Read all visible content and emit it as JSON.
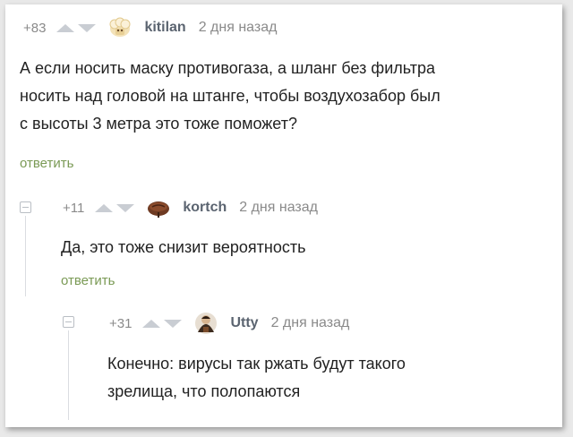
{
  "comments": [
    {
      "rating": "+83",
      "author": "kitilan",
      "time": "2 дня назад",
      "text_lines": [
        "А если носить маску противогаза, а шланг без фильтра",
        "носить над головой на штанге, чтобы воздухозабор был",
        "с высоты 3 метра это тоже поможет?"
      ],
      "reply": "ответить",
      "avatar_icon": "sheep-avatar-icon"
    },
    {
      "rating": "+11",
      "author": "kortch",
      "time": "2 дня назад",
      "text_lines": [
        "Да, это тоже снизит вероятность"
      ],
      "reply": "ответить",
      "avatar_icon": "bread-avatar-icon"
    },
    {
      "rating": "+31",
      "author": "Utty",
      "time": "2 дня назад",
      "text_lines": [
        "Конечно: вирусы так ржать будут такого",
        "зрелища, что полопаются"
      ],
      "avatar_icon": "cartoon-avatar-icon"
    }
  ],
  "colors": {
    "reply_link": "#7a9a55",
    "author": "#5b6470",
    "muted": "#8a8a8a",
    "vote_arrow": "#c9cdd3"
  }
}
